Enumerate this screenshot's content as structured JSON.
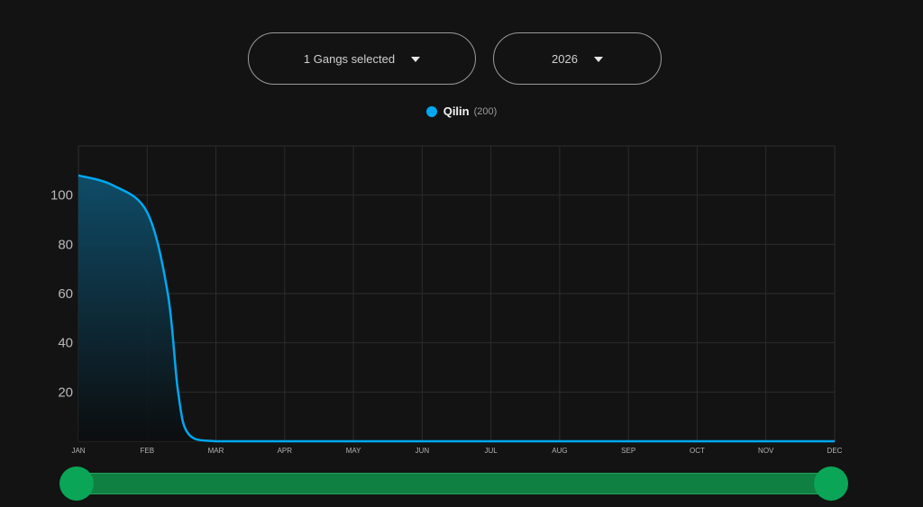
{
  "filters": {
    "gangs_label": "1 Gangs selected",
    "year_label": "2026"
  },
  "legend": {
    "series_name": "Qilin",
    "series_count": "(200)",
    "series_color": "#00a8f0"
  },
  "range_slider": {
    "start": 0,
    "end": 1
  },
  "chart_data": {
    "type": "area",
    "title": "",
    "xlabel": "",
    "ylabel": "",
    "x_ticks": [
      "JAN",
      "FEB",
      "MAR",
      "APR",
      "MAY",
      "JUN",
      "JUL",
      "AUG",
      "SEP",
      "OCT",
      "NOV",
      "DEC"
    ],
    "y_ticks": [
      20,
      40,
      60,
      80,
      100
    ],
    "ylim": [
      0,
      120
    ],
    "grid": true,
    "legend_position": "top-center",
    "series": [
      {
        "name": "Qilin",
        "color": "#00a8f0",
        "x": [
          0,
          0.5,
          1.0,
          1.3,
          1.45,
          1.6,
          2.0,
          3,
          4,
          5,
          6,
          7,
          8,
          9,
          10,
          11
        ],
        "values": [
          108,
          104,
          93,
          60,
          20,
          3,
          0,
          0,
          0,
          0,
          0,
          0,
          0,
          0,
          0,
          0
        ]
      }
    ]
  }
}
